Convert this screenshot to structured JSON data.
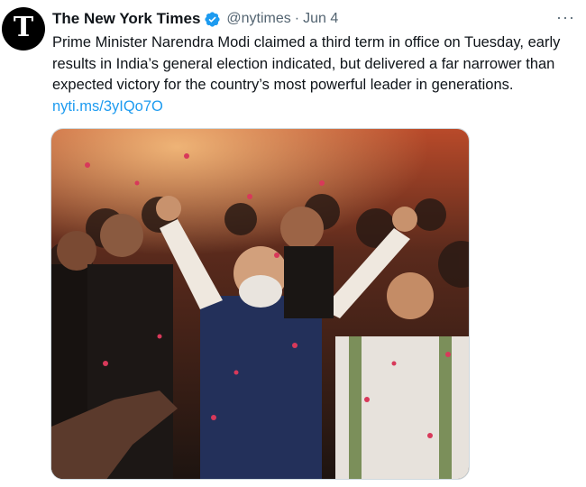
{
  "tweet": {
    "author_name": "The New York Times",
    "handle": "@nytimes",
    "separator": "·",
    "date": "Jun 4",
    "avatar_letter": "T",
    "more_label": "···",
    "text": "Prime Minister Narendra Modi claimed a third term in office on Tuesday, early results in India’s general election indicated, but delivered a far narrower than expected victory for the country’s most powerful leader in generations. ",
    "link": "nyti.ms/3yIQo7O",
    "verified_color": "#1d9bf0",
    "link_color": "#1d9bf0"
  },
  "media": {
    "icon": "photo"
  }
}
